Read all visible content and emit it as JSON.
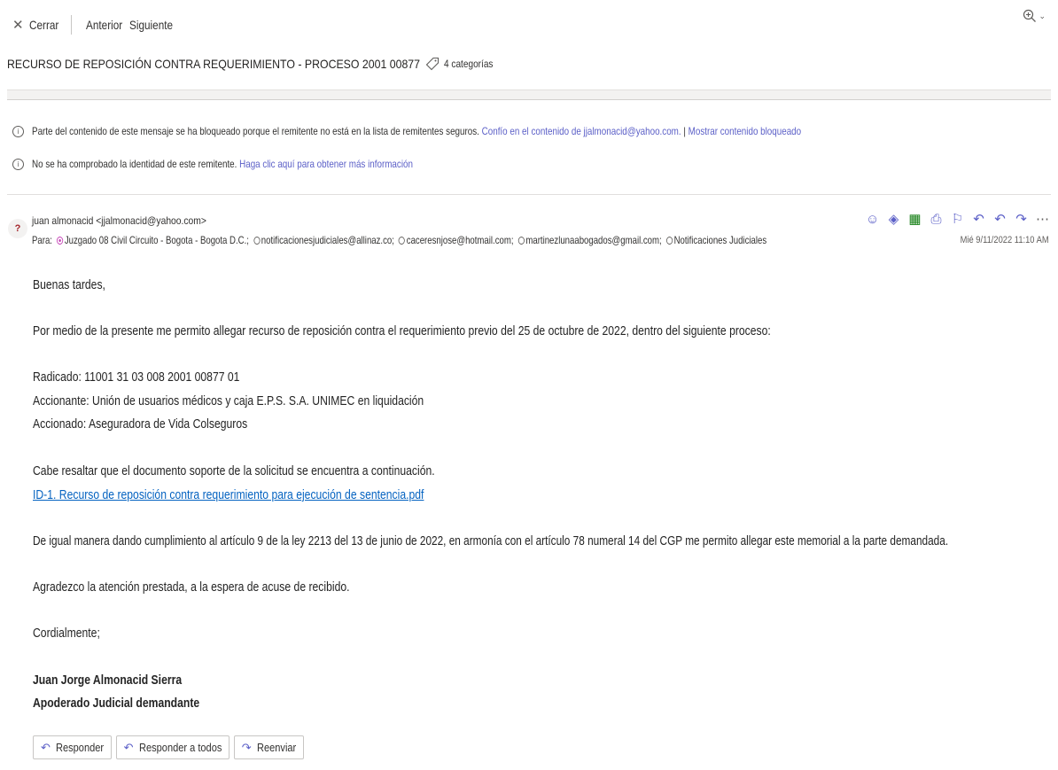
{
  "toolbar": {
    "close_label": "Cerrar",
    "prev_label": "Anterior",
    "next_label": "Siguiente"
  },
  "message": {
    "subject": "RECURSO DE REPOSICIÓN CONTRA REQUERIMIENTO - PROCESO 2001 00877",
    "categories_label": "4 categorías"
  },
  "notices": {
    "blocked_text": "Parte del contenido de este mensaje se ha bloqueado porque el remitente no está en la lista de remitentes seguros.",
    "trust_link": "Confío en el contenido de jjalmonacid@yahoo.com.",
    "separator": " | ",
    "show_blocked_link": "Mostrar contenido bloqueado",
    "identity_text": "No se ha comprobado la identidad de este remitente.",
    "more_info_link": "Haga clic aquí para obtener más información"
  },
  "header": {
    "avatar_initial": "?",
    "sender": "juan almonacid <jjalmonacid@yahoo.com>",
    "to_label": "Para:",
    "recipients": [
      "Juzgado 08 Civil Circuito - Bogota - Bogota D.C.;",
      "notificacionesjudiciales@allinaz.co;",
      "caceresnjose@hotmail.com;",
      "martinezlunaabogados@gmail.com;",
      "Notificaciones Judiciales"
    ],
    "date": "Mié 9/11/2022 11:10 AM"
  },
  "body": {
    "greeting": "Buenas tardes,",
    "p1": "Por medio de la presente me permito allegar recurso de reposición contra el requerimiento previo del 25 de octubre de 2022, dentro del siguiente proceso:",
    "radicado": "Radicado: 11001 31 03 008 2001 00877 01",
    "accionante": "Accionante: Unión de usuarios médicos y caja E.P.S. S.A. UNIMEC en liquidación",
    "accionado": "Accionado: Aseguradora de Vida Colseguros",
    "p2": "Cabe resaltar que el documento soporte de la solicitud se encuentra a continuación.",
    "attachment_link": "ID-1. Recurso de reposición contra requerimiento para ejecución de sentencia.pdf",
    "p3": "De igual manera dando cumplimiento al artículo 9 de la ley 2213 del 13 de junio de 2022, en armonía con el artículo 78 numeral 14 del CGP me permito allegar este memorial a la parte demandada.",
    "p4": "Agradezco la atención prestada, a la espera de acuse de recibido.",
    "closing": "Cordialmente;",
    "sig_name": "Juan Jorge Almonacid Sierra",
    "sig_title": "Apoderado Judicial demandante"
  },
  "reply_bar": {
    "reply": "Responder",
    "reply_all": "Responder a todos",
    "forward": "Reenviar"
  },
  "colors": {
    "accent": "#5b5fc7",
    "link": "#0563c1"
  }
}
